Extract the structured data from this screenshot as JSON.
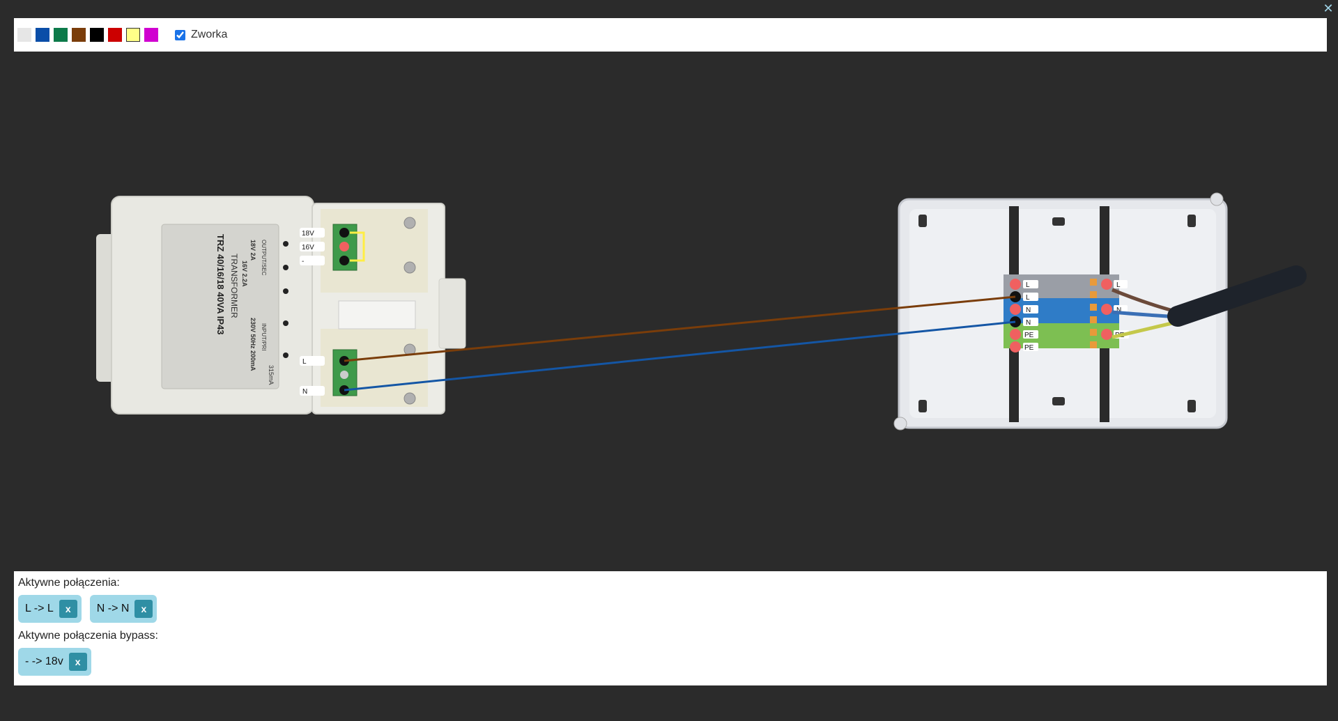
{
  "window": {
    "close_label": "✕"
  },
  "toolbar": {
    "swatches": [
      {
        "name": "white",
        "color": "#e6e6e6"
      },
      {
        "name": "blue",
        "color": "#0a4ea8"
      },
      {
        "name": "green",
        "color": "#0c7a4a"
      },
      {
        "name": "brown",
        "color": "#7a3d0a"
      },
      {
        "name": "black",
        "color": "#000000"
      },
      {
        "name": "red",
        "color": "#cc0000"
      },
      {
        "name": "yellow",
        "color": "#ffff88"
      },
      {
        "name": "magenta",
        "color": "#d000d0"
      }
    ],
    "zworka_label": "Zworka",
    "zworka_checked": true
  },
  "transformer": {
    "label_lines": [
      "TRANSFORMER",
      "TRZ 40/16/18 40VA IP43"
    ],
    "output_terminals": [
      "18V",
      "16V",
      "-"
    ],
    "input_terminals": [
      "L",
      "N"
    ],
    "ratings": [
      "18V 2A",
      "16V 2.2A",
      "230V 50Hz 200mA",
      "315mA",
      "OUTPUT/SEC",
      "INPUT/PRI"
    ]
  },
  "junction_box": {
    "left_terminals": [
      "L",
      "L",
      "N",
      "N",
      "PE",
      "PE"
    ],
    "right_terminals": [
      "L",
      "N",
      "PE"
    ]
  },
  "wires": [
    {
      "from": "L",
      "to": "L",
      "color": "#7a3d0a"
    },
    {
      "from": "N",
      "to": "N",
      "color": "#1456a5"
    }
  ],
  "bottom": {
    "active_label": "Aktywne połączenia:",
    "active": [
      {
        "label": "L -> L",
        "remove": "x"
      },
      {
        "label": "N -> N",
        "remove": "x"
      }
    ],
    "bypass_label": "Aktywne połączenia bypass:",
    "bypass": [
      {
        "label": "- -> 18v",
        "remove": "x"
      }
    ]
  }
}
